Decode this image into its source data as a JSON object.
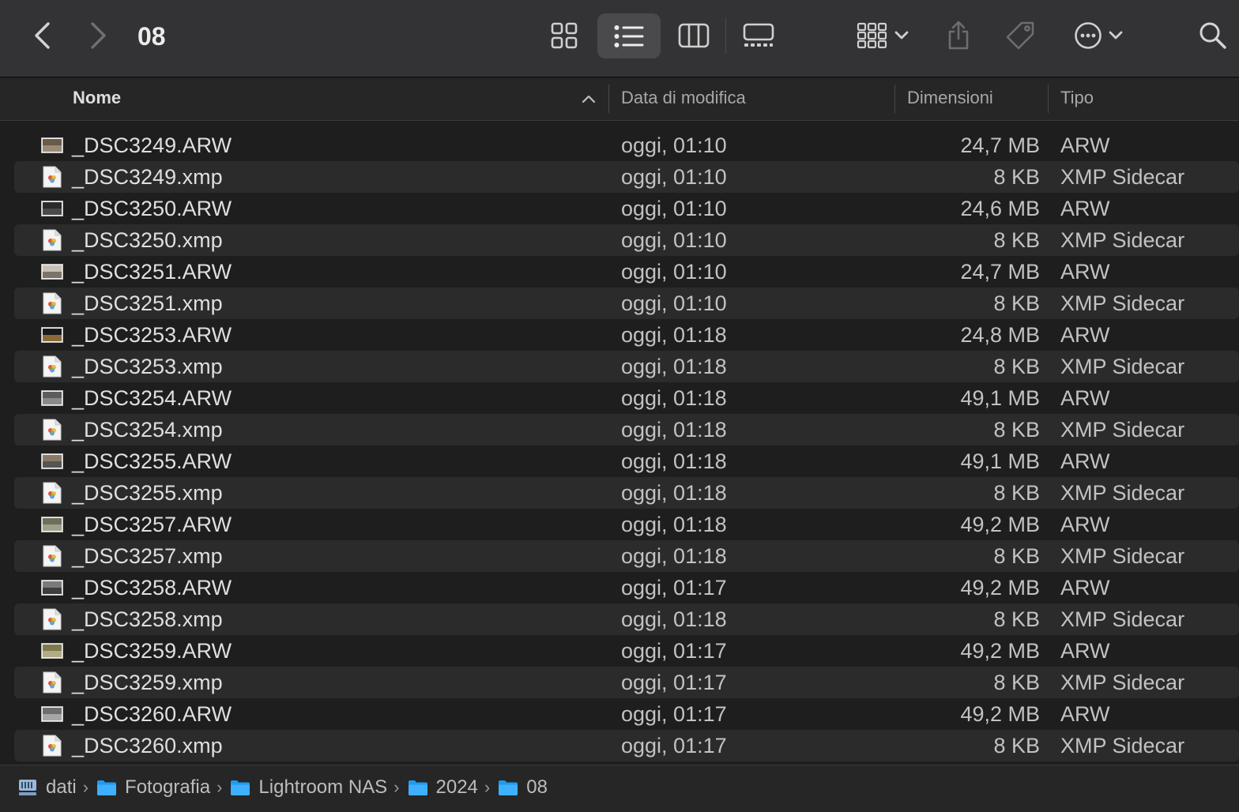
{
  "window": {
    "title": "08"
  },
  "toolbar": {
    "icons": [
      "chevron-left-icon",
      "chevron-right-icon",
      "grid-view-icon",
      "list-view-icon",
      "columns-view-icon",
      "gallery-view-icon",
      "group-icon",
      "share-icon",
      "tag-icon",
      "more-icon",
      "search-icon"
    ],
    "active_view": "list"
  },
  "columns": {
    "name": "Nome",
    "date": "Data di modifica",
    "size": "Dimensioni",
    "kind": "Tipo"
  },
  "files": [
    {
      "name": "_DSC3249.ARW",
      "date": "oggi, 01:10",
      "size": "24,7 MB",
      "kind": "ARW",
      "icon": "raw-thumb-icon"
    },
    {
      "name": "_DSC3249.xmp",
      "date": "oggi, 01:10",
      "size": "8 KB",
      "kind": "XMP Sidecar",
      "icon": "xmp-file-icon"
    },
    {
      "name": "_DSC3250.ARW",
      "date": "oggi, 01:10",
      "size": "24,6 MB",
      "kind": "ARW",
      "icon": "raw-thumb-icon"
    },
    {
      "name": "_DSC3250.xmp",
      "date": "oggi, 01:10",
      "size": "8 KB",
      "kind": "XMP Sidecar",
      "icon": "xmp-file-icon"
    },
    {
      "name": "_DSC3251.ARW",
      "date": "oggi, 01:10",
      "size": "24,7 MB",
      "kind": "ARW",
      "icon": "raw-thumb-icon"
    },
    {
      "name": "_DSC3251.xmp",
      "date": "oggi, 01:10",
      "size": "8 KB",
      "kind": "XMP Sidecar",
      "icon": "xmp-file-icon"
    },
    {
      "name": "_DSC3253.ARW",
      "date": "oggi, 01:18",
      "size": "24,8 MB",
      "kind": "ARW",
      "icon": "raw-thumb-icon"
    },
    {
      "name": "_DSC3253.xmp",
      "date": "oggi, 01:18",
      "size": "8 KB",
      "kind": "XMP Sidecar",
      "icon": "xmp-file-icon"
    },
    {
      "name": "_DSC3254.ARW",
      "date": "oggi, 01:18",
      "size": "49,1 MB",
      "kind": "ARW",
      "icon": "raw-thumb-icon"
    },
    {
      "name": "_DSC3254.xmp",
      "date": "oggi, 01:18",
      "size": "8 KB",
      "kind": "XMP Sidecar",
      "icon": "xmp-file-icon"
    },
    {
      "name": "_DSC3255.ARW",
      "date": "oggi, 01:18",
      "size": "49,1 MB",
      "kind": "ARW",
      "icon": "raw-thumb-icon"
    },
    {
      "name": "_DSC3255.xmp",
      "date": "oggi, 01:18",
      "size": "8 KB",
      "kind": "XMP Sidecar",
      "icon": "xmp-file-icon"
    },
    {
      "name": "_DSC3257.ARW",
      "date": "oggi, 01:18",
      "size": "49,2 MB",
      "kind": "ARW",
      "icon": "raw-thumb-icon"
    },
    {
      "name": "_DSC3257.xmp",
      "date": "oggi, 01:18",
      "size": "8 KB",
      "kind": "XMP Sidecar",
      "icon": "xmp-file-icon"
    },
    {
      "name": "_DSC3258.ARW",
      "date": "oggi, 01:17",
      "size": "49,2 MB",
      "kind": "ARW",
      "icon": "raw-thumb-icon"
    },
    {
      "name": "_DSC3258.xmp",
      "date": "oggi, 01:18",
      "size": "8 KB",
      "kind": "XMP Sidecar",
      "icon": "xmp-file-icon"
    },
    {
      "name": "_DSC3259.ARW",
      "date": "oggi, 01:17",
      "size": "49,2 MB",
      "kind": "ARW",
      "icon": "raw-thumb-icon"
    },
    {
      "name": "_DSC3259.xmp",
      "date": "oggi, 01:17",
      "size": "8 KB",
      "kind": "XMP Sidecar",
      "icon": "xmp-file-icon"
    },
    {
      "name": "_DSC3260.ARW",
      "date": "oggi, 01:17",
      "size": "49,2 MB",
      "kind": "ARW",
      "icon": "raw-thumb-icon"
    },
    {
      "name": "_DSC3260.xmp",
      "date": "oggi, 01:17",
      "size": "8 KB",
      "kind": "XMP Sidecar",
      "icon": "xmp-file-icon"
    }
  ],
  "path": [
    {
      "label": "dati",
      "icon": "network-drive-icon"
    },
    {
      "label": "Fotografia",
      "icon": "folder-icon"
    },
    {
      "label": "Lightroom NAS",
      "icon": "folder-icon"
    },
    {
      "label": "2024",
      "icon": "folder-icon"
    },
    {
      "label": "08",
      "icon": "folder-icon"
    }
  ],
  "colors": {
    "background": "#1e1e1e",
    "toolbar": "#333335",
    "row_alt": "#2b2b2b",
    "folder": "#1f9bf0",
    "text": "#dfdfdf"
  }
}
